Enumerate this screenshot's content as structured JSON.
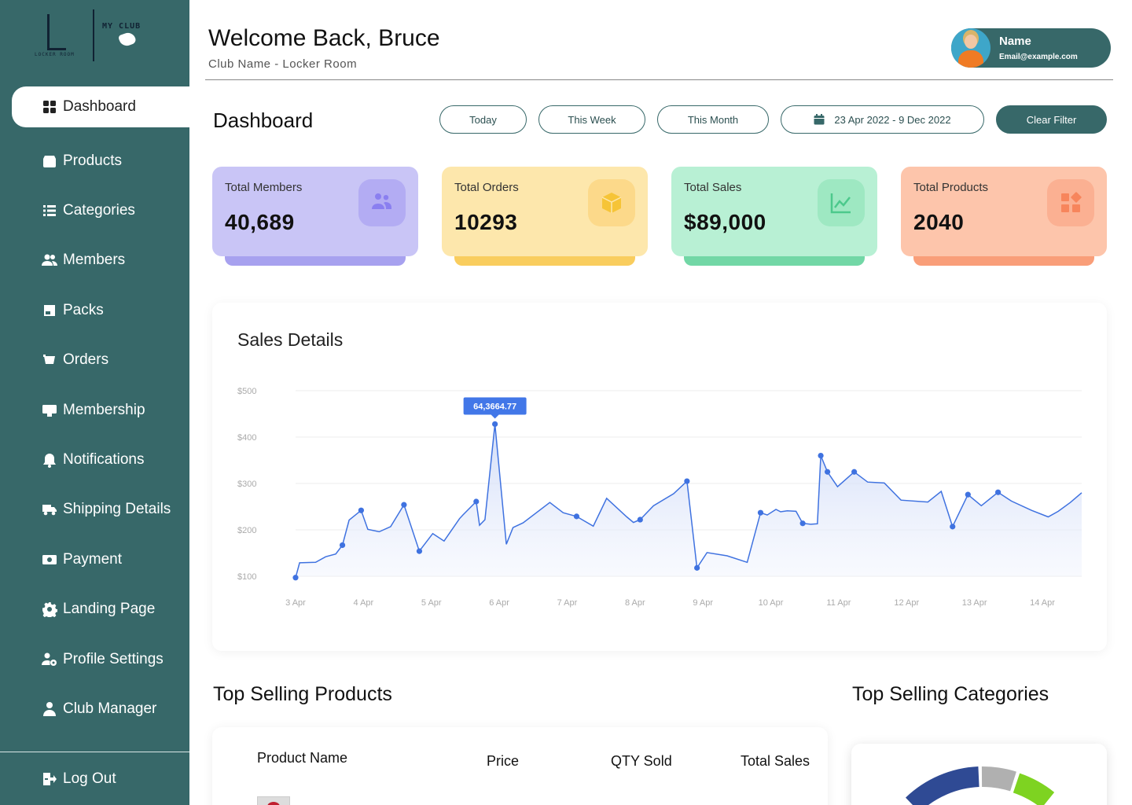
{
  "sidebar": {
    "logo": {
      "text_left": "LOCKER ROOM",
      "text_right": "MY CLUB"
    },
    "items": [
      {
        "label": "Dashboard",
        "icon": "grid-icon"
      },
      {
        "label": "Products",
        "icon": "box-icon"
      },
      {
        "label": "Categories",
        "icon": "list-icon"
      },
      {
        "label": "Members",
        "icon": "users-icon"
      },
      {
        "label": "Packs",
        "icon": "pack-icon"
      },
      {
        "label": "Orders",
        "icon": "cart-icon"
      },
      {
        "label": "Membership",
        "icon": "card-icon"
      },
      {
        "label": "Notifications",
        "icon": "bell-icon"
      },
      {
        "label": "Shipping Details",
        "icon": "truck-icon"
      },
      {
        "label": "Payment",
        "icon": "money-icon"
      },
      {
        "label": "Landing Page",
        "icon": "gear-icon"
      },
      {
        "label": "Profile Settings",
        "icon": "user-gear-icon"
      },
      {
        "label": "Club Manager",
        "icon": "person-icon"
      }
    ],
    "logout": "Log Out"
  },
  "header": {
    "welcome": "Welcome Back, Bruce",
    "club": "Club Name - Locker Room",
    "profile": {
      "name": "Name",
      "email": "Email@example.com"
    }
  },
  "dashboard": {
    "title": "Dashboard",
    "filters": {
      "today": "Today",
      "week": "This Week",
      "month": "This Month",
      "range": "23 Apr 2022 - 9 Dec 2022",
      "clear": "Clear Filter"
    }
  },
  "stats": [
    {
      "label": "Total Members",
      "value": "40,689",
      "bg": "#c9c5f6",
      "under": "#a7a1ef",
      "icoBg": "#b3acf3",
      "icoColor": "#8a7ff0"
    },
    {
      "label": "Total Orders",
      "value": "10293",
      "bg": "#fde7ac",
      "under": "#f9cd5e",
      "icoBg": "#fcd98a",
      "icoColor": "#f6c437"
    },
    {
      "label": "Total Sales",
      "value": "$89,000",
      "bg": "#b8f0d4",
      "under": "#72d7a6",
      "icoBg": "#9ee8c2",
      "icoColor": "#4cc98c"
    },
    {
      "label": "Total Products",
      "value": "2040",
      "bg": "#fdc5ab",
      "under": "#f99e79",
      "icoBg": "#fbb092",
      "icoColor": "#f7855c"
    }
  ],
  "sales": {
    "title": "Sales Details",
    "tooltip": "64,3664.77"
  },
  "chart_data": {
    "type": "line",
    "title": "Sales Details",
    "xlabel": "",
    "ylabel": "",
    "ylim": [
      100,
      500
    ],
    "yticks": [
      "$100",
      "$200",
      "$300",
      "$400",
      "$500"
    ],
    "categories": [
      "3 Apr",
      "4 Apr",
      "5 Apr",
      "6 Apr",
      "7 Apr",
      "8 Apr",
      "9 Apr",
      "10 Apr",
      "11 Apr",
      "12 Apr",
      "13 Apr",
      "14 Apr"
    ],
    "grid": true,
    "fill": true,
    "color": "#3f72e0",
    "x": [
      3.0,
      3.06,
      3.3,
      3.45,
      3.6,
      3.7,
      3.8,
      3.98,
      4.08,
      4.25,
      4.42,
      4.62,
      4.85,
      5.05,
      5.22,
      5.45,
      5.5,
      5.7,
      5.75,
      5.83,
      5.98,
      6.15,
      6.25,
      6.4,
      6.8,
      7.0,
      7.2,
      7.45,
      7.65,
      7.95,
      8.05,
      8.15,
      8.35,
      8.65,
      8.85,
      9.0,
      9.15,
      9.45,
      9.75,
      9.95,
      10.05,
      10.18,
      10.25,
      10.35,
      10.48,
      10.58,
      10.7,
      10.8,
      10.85,
      10.95,
      11.1,
      11.35,
      11.55,
      11.8,
      12.05,
      12.45,
      12.65,
      12.82,
      13.05,
      13.25,
      13.5,
      13.7,
      14.0,
      14.25,
      14.4,
      14.58,
      14.75
    ],
    "y": [
      97,
      129,
      130,
      142,
      148,
      167,
      221,
      242,
      201,
      196,
      207,
      254,
      154,
      192,
      176,
      224,
      232,
      261,
      210,
      222,
      428,
      169,
      205,
      215,
      259,
      237,
      229,
      208,
      268,
      228,
      216,
      222,
      252,
      278,
      305,
      118,
      151,
      144,
      130,
      237,
      232,
      244,
      239,
      241,
      240,
      214,
      212,
      213,
      360,
      325,
      293,
      325,
      303,
      301,
      264,
      260,
      283,
      207,
      276,
      252,
      281,
      262,
      242,
      228,
      240,
      259,
      280
    ]
  },
  "bottom": {
    "products_title": "Top Selling Products",
    "categories_title": "Top Selling Categories",
    "table_headers": {
      "name": "Product Name",
      "price": "Price",
      "qty": "QTY Sold",
      "total": "Total Sales"
    }
  }
}
